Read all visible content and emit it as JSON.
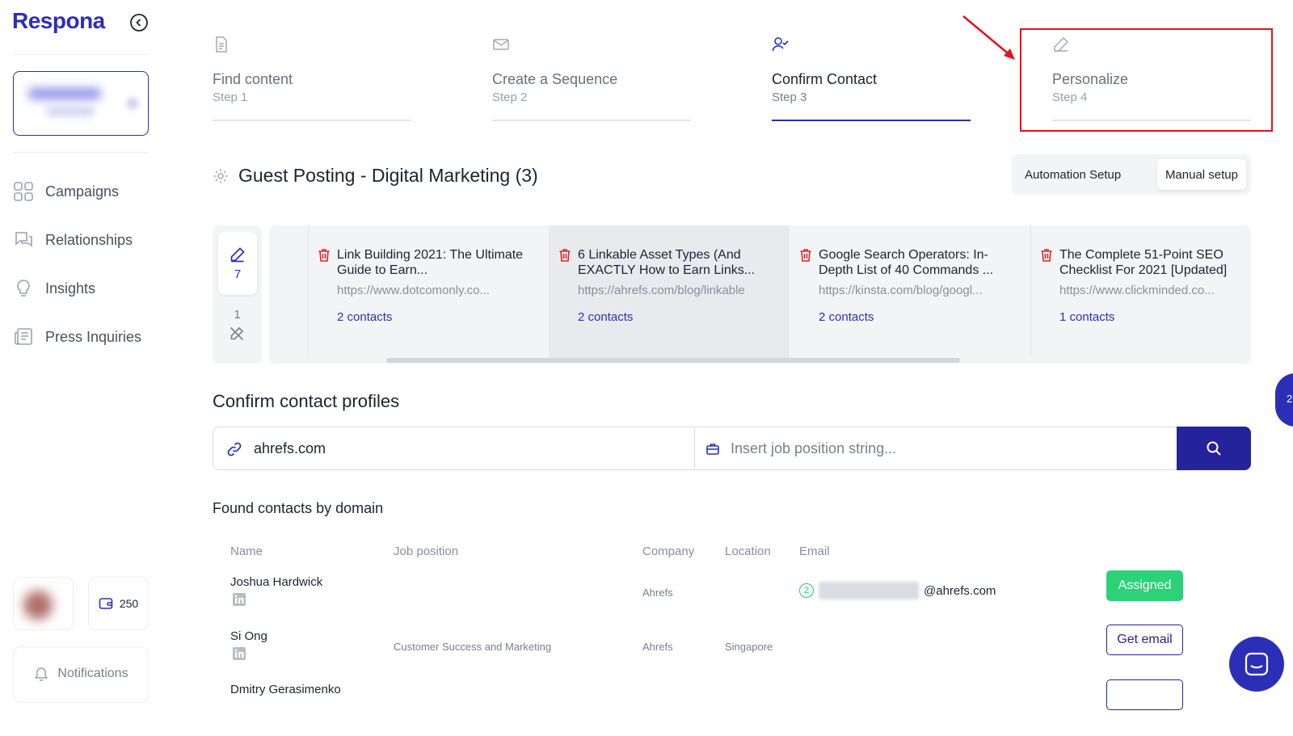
{
  "app": {
    "logo": "Respona"
  },
  "sidebar": {
    "nav": [
      {
        "label": "Campaigns",
        "icon": "grid-icon"
      },
      {
        "label": "Relationships",
        "icon": "chat-icon"
      },
      {
        "label": "Insights",
        "icon": "lightbulb-icon"
      },
      {
        "label": "Press Inquiries",
        "icon": "newspaper-icon"
      }
    ],
    "credits": "250",
    "notifications_label": "Notifications"
  },
  "steps": [
    {
      "title": "Find content",
      "sub": "Step 1",
      "icon": "document-icon",
      "active": false
    },
    {
      "title": "Create a Sequence",
      "sub": "Step 2",
      "icon": "envelope-icon",
      "active": false
    },
    {
      "title": "Confirm Contact",
      "sub": "Step 3",
      "icon": "user-check-icon",
      "active": true
    },
    {
      "title": "Personalize",
      "sub": "Step 4",
      "icon": "pencil-icon",
      "active": false
    }
  ],
  "campaign": {
    "title": "Guest Posting - Digital Marketing (3)",
    "mode_options": [
      "Automation Setup",
      "Manual setup"
    ],
    "mode_selected": "Manual setup"
  },
  "pager": {
    "active_count": "7",
    "other_count": "1"
  },
  "content_cards": [
    {
      "title": "Link Building 2021: The Ultimate Guide to Earn...",
      "url": "https://www.dotcomonly.co...",
      "contacts": "2 contacts",
      "selected": false
    },
    {
      "title": "6 Linkable Asset Types (And EXACTLY How to Earn Links...",
      "url": "https://ahrefs.com/blog/linkable",
      "contacts": "2 contacts",
      "selected": true
    },
    {
      "title": "Google Search Operators: In-Depth List of 40 Commands ...",
      "url": "https://kinsta.com/blog/googl...",
      "contacts": "2 contacts",
      "selected": false
    },
    {
      "title": "The Complete 51-Point SEO Checklist For 2021 [Updated]",
      "url": "https://www.clickminded.co...",
      "contacts": "1 contacts",
      "selected": false
    }
  ],
  "confirm": {
    "title": "Confirm contact profiles",
    "domain_value": "ahrefs.com",
    "job_placeholder": "Insert job position string..."
  },
  "found": {
    "title": "Found contacts by domain",
    "headers": {
      "name": "Name",
      "job": "Job position",
      "company": "Company",
      "location": "Location",
      "email": "Email"
    },
    "rows": [
      {
        "name": "Joshua Hardwick",
        "job": "",
        "company": "Ahrefs",
        "location": "",
        "email_badge": "2",
        "email_domain": "@ahrefs.com",
        "action": "Assigned"
      },
      {
        "name": "Si Ong",
        "job": "Customer Success and Marketing",
        "company": "Ahrefs",
        "location": "Singapore",
        "action": "Get email"
      },
      {
        "name": "Dmitry Gerasimenko"
      }
    ]
  },
  "side_bubble": "2",
  "colors": {
    "brand": "#2b2fb8",
    "danger": "#e0242f",
    "success": "#2cd178",
    "highlight": "#e5121f"
  }
}
